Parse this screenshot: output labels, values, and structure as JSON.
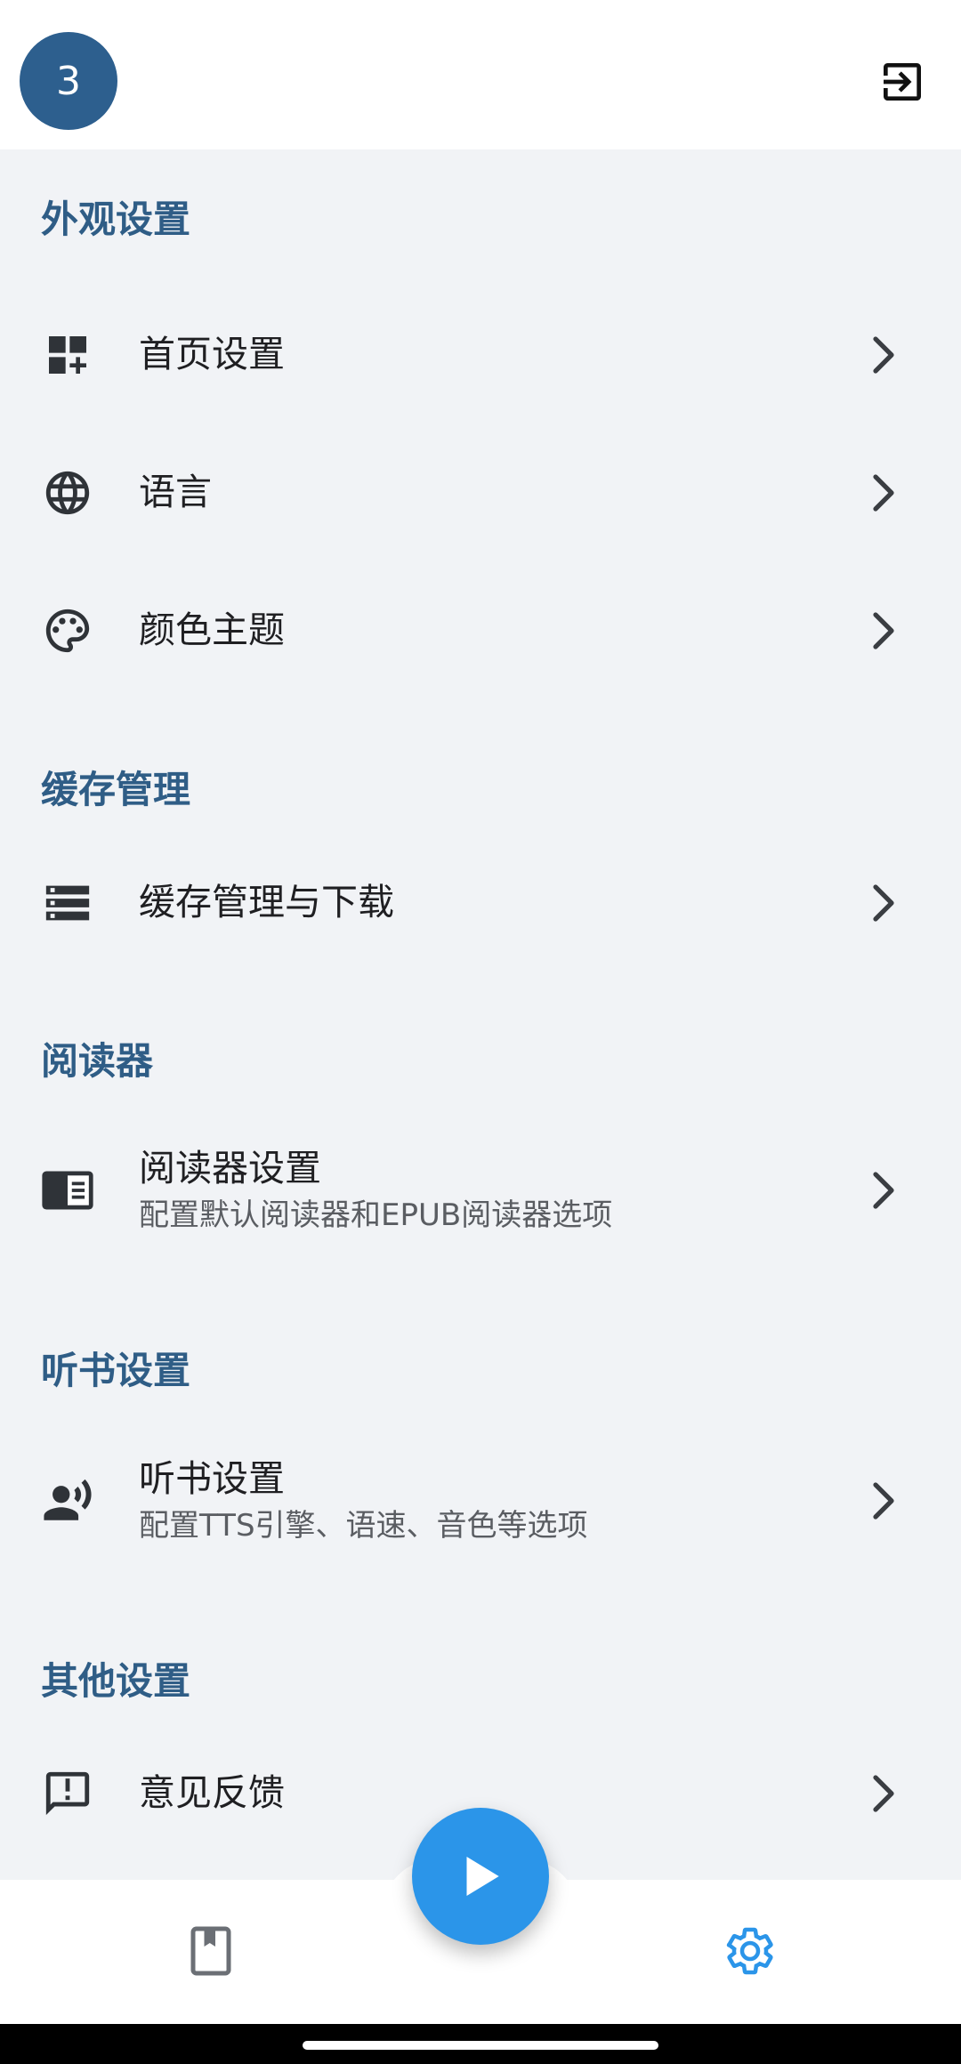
{
  "header": {
    "avatar_text": "3",
    "exit_icon": "exit-to-app-icon"
  },
  "sections": {
    "appearance": {
      "title": "外观设置",
      "items": [
        {
          "label": "首页设置",
          "icon": "dashboard-add-icon"
        },
        {
          "label": "语言",
          "icon": "globe-icon"
        },
        {
          "label": "颜色主题",
          "icon": "palette-icon"
        }
      ]
    },
    "cache": {
      "title": "缓存管理",
      "items": [
        {
          "label": "缓存管理与下载",
          "icon": "storage-icon"
        }
      ]
    },
    "reader": {
      "title": "阅读器",
      "items": [
        {
          "label": "阅读器设置",
          "sub": "配置默认阅读器和EPUB阅读器选项",
          "icon": "reader-icon"
        }
      ]
    },
    "listen": {
      "title": "听书设置",
      "items": [
        {
          "label": "听书设置",
          "sub": "配置TTS引擎、语速、音色等选项",
          "icon": "record-voice-icon"
        }
      ]
    },
    "other": {
      "title": "其他设置",
      "items": [
        {
          "label": "意见反馈",
          "icon": "feedback-icon"
        }
      ]
    }
  },
  "bottom_nav": {
    "items": [
      {
        "icon": "book-icon",
        "active": false
      },
      {
        "icon": "gear-icon",
        "active": true
      }
    ],
    "fab_icon": "play-icon"
  },
  "colors": {
    "accent": "#2b95e9",
    "section_title": "#2f5d86",
    "avatar_bg": "#2d5f8e",
    "background": "#f1f3f6"
  }
}
